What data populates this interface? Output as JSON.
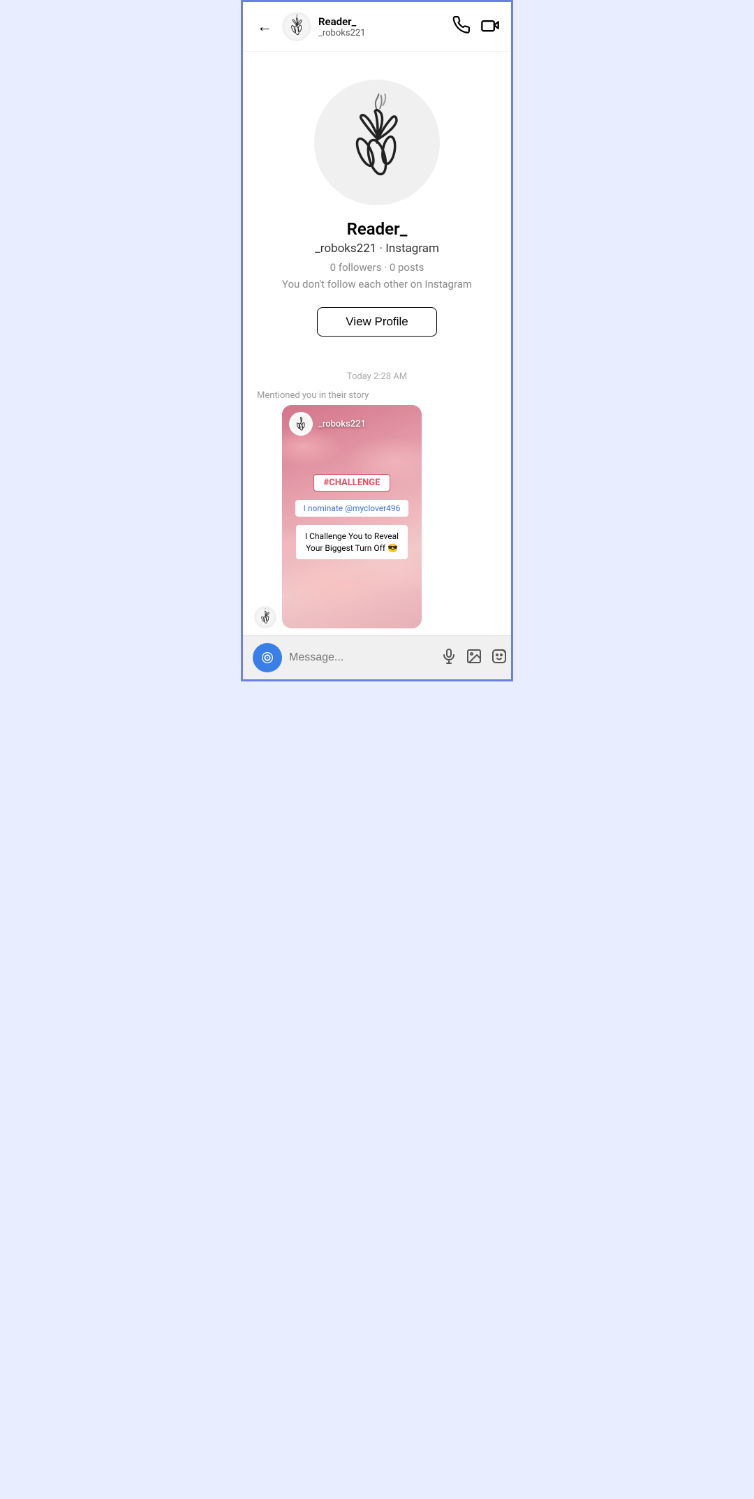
{
  "header": {
    "back_label": "←",
    "username_display": "Reader_",
    "username_handle": "_roboks221",
    "call_icon": "phone-icon",
    "video_icon": "video-icon"
  },
  "profile": {
    "name": "Reader_",
    "handle_platform": "_roboks221 · Instagram",
    "stats": "0 followers · 0 posts",
    "follow_status": "You don't follow each other on Instagram",
    "view_profile_btn": "View Profile"
  },
  "chat": {
    "timestamp": "Today 2:28 AM",
    "mention_label": "Mentioned you in their story",
    "story": {
      "username": "_roboks221",
      "challenge_tag": "#CHALLENGE",
      "nominate_text": "I nominate @myclover496",
      "challenge_body": "I Challenge You to Reveal Your Biggest Turn Off 😎"
    }
  },
  "input_bar": {
    "placeholder": "Message...",
    "microphone_icon": "microphone-icon",
    "image_icon": "image-icon",
    "sticker_icon": "sticker-icon",
    "camera_icon": "camera-icon"
  }
}
